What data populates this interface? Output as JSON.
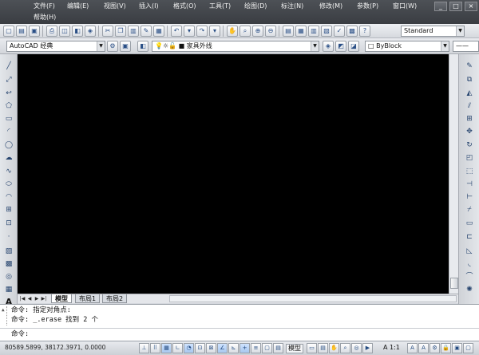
{
  "menubar": {
    "items": [
      "文件(F)",
      "编辑(E)",
      "视图(V)",
      "插入(I)",
      "格式(O)",
      "工具(T)",
      "绘图(D)",
      "标注(N)",
      "修改(M)",
      "参数(P)",
      "窗口(W)",
      "帮助(H)"
    ],
    "window_buttons": [
      "_",
      "□",
      "×"
    ]
  },
  "toolbar": {
    "workspace": "AutoCAD 经典",
    "layer": "家具外线",
    "linetype": "ByBlock",
    "text_style": "Standard"
  },
  "tabs": {
    "nav": [
      "|◀",
      "◀",
      "▶",
      "▶|"
    ],
    "items": [
      "模型",
      "布局1",
      "布局2"
    ]
  },
  "command": {
    "prompt_char": "▲",
    "lines": [
      "命令: 指定对角点:",
      "命令: _.erase 找到 2 个"
    ],
    "input_label": "命令:"
  },
  "statusbar": {
    "coordinates": "80589.5899, 38172.3971, 0.0000",
    "model_label": "模型",
    "annotation_scale": "A 1:1"
  },
  "colors": {
    "menubar": "#3a3d42",
    "canvas": "#000000",
    "toolbar": "#d6d9de"
  }
}
